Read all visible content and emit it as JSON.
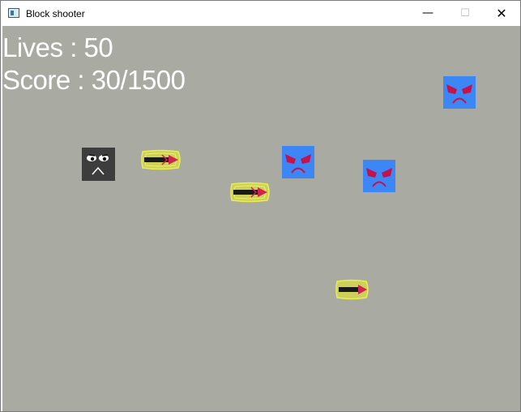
{
  "window": {
    "title": "Block shooter",
    "controls": [
      "minimize",
      "maximize",
      "close"
    ]
  },
  "hud": {
    "lives_label": "Lives : 50",
    "score_label": "Score : 30/1500"
  },
  "game": {
    "background_color": "#a9aaa2",
    "player": {
      "icon": "grey-face-block",
      "color": "#3d3d3d"
    },
    "enemies": [
      {
        "icon": "angry-blue-block",
        "color": "#3d86f5"
      },
      {
        "icon": "angry-blue-block",
        "color": "#3d86f5"
      },
      {
        "icon": "angry-blue-block",
        "color": "#3d86f5"
      }
    ],
    "bullets": [
      {
        "icon": "yellow-bullet"
      },
      {
        "icon": "yellow-bullet"
      },
      {
        "icon": "yellow-bullet"
      }
    ]
  }
}
